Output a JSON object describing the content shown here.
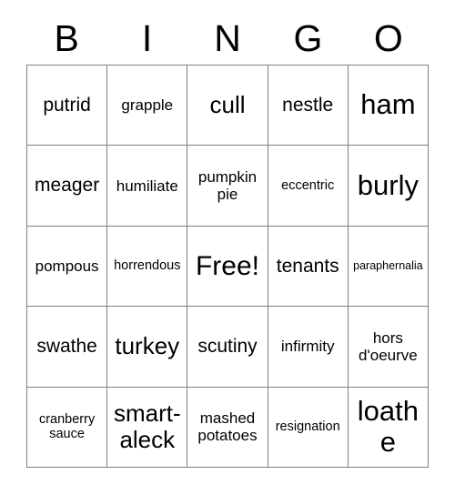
{
  "card": {
    "header_letters": [
      "B",
      "I",
      "N",
      "G",
      "O"
    ],
    "rows": [
      [
        {
          "text": "putrid",
          "size": "lg"
        },
        {
          "text": "grapple",
          "size": "md"
        },
        {
          "text": "cull",
          "size": "xl"
        },
        {
          "text": "nestle",
          "size": "lg"
        },
        {
          "text": "ham",
          "size": "xxl"
        }
      ],
      [
        {
          "text": "meager",
          "size": "lg"
        },
        {
          "text": "humiliate",
          "size": "md"
        },
        {
          "text": "pumpkin pie",
          "size": "md"
        },
        {
          "text": "eccentric",
          "size": "sm"
        },
        {
          "text": "burly",
          "size": "xxl"
        }
      ],
      [
        {
          "text": "pompous",
          "size": "md"
        },
        {
          "text": "horrendous",
          "size": "sm"
        },
        {
          "text": "Free!",
          "size": "free"
        },
        {
          "text": "tenants",
          "size": "lg"
        },
        {
          "text": "paraphernalia",
          "size": "xs"
        }
      ],
      [
        {
          "text": "swathe",
          "size": "lg"
        },
        {
          "text": "turkey",
          "size": "xl"
        },
        {
          "text": "scutiny",
          "size": "lg"
        },
        {
          "text": "infirmity",
          "size": "md"
        },
        {
          "text": "hors d'oeurve",
          "size": "md"
        }
      ],
      [
        {
          "text": "cranberry sauce",
          "size": "sm"
        },
        {
          "text": "smart-aleck",
          "size": "xl"
        },
        {
          "text": "mashed potatoes",
          "size": "md"
        },
        {
          "text": "resignation",
          "size": "sm"
        },
        {
          "text": "loathe",
          "size": "xxl"
        }
      ]
    ]
  },
  "colors": {
    "background": "#ffffff",
    "text": "#000000",
    "grid_line": "#808080"
  }
}
